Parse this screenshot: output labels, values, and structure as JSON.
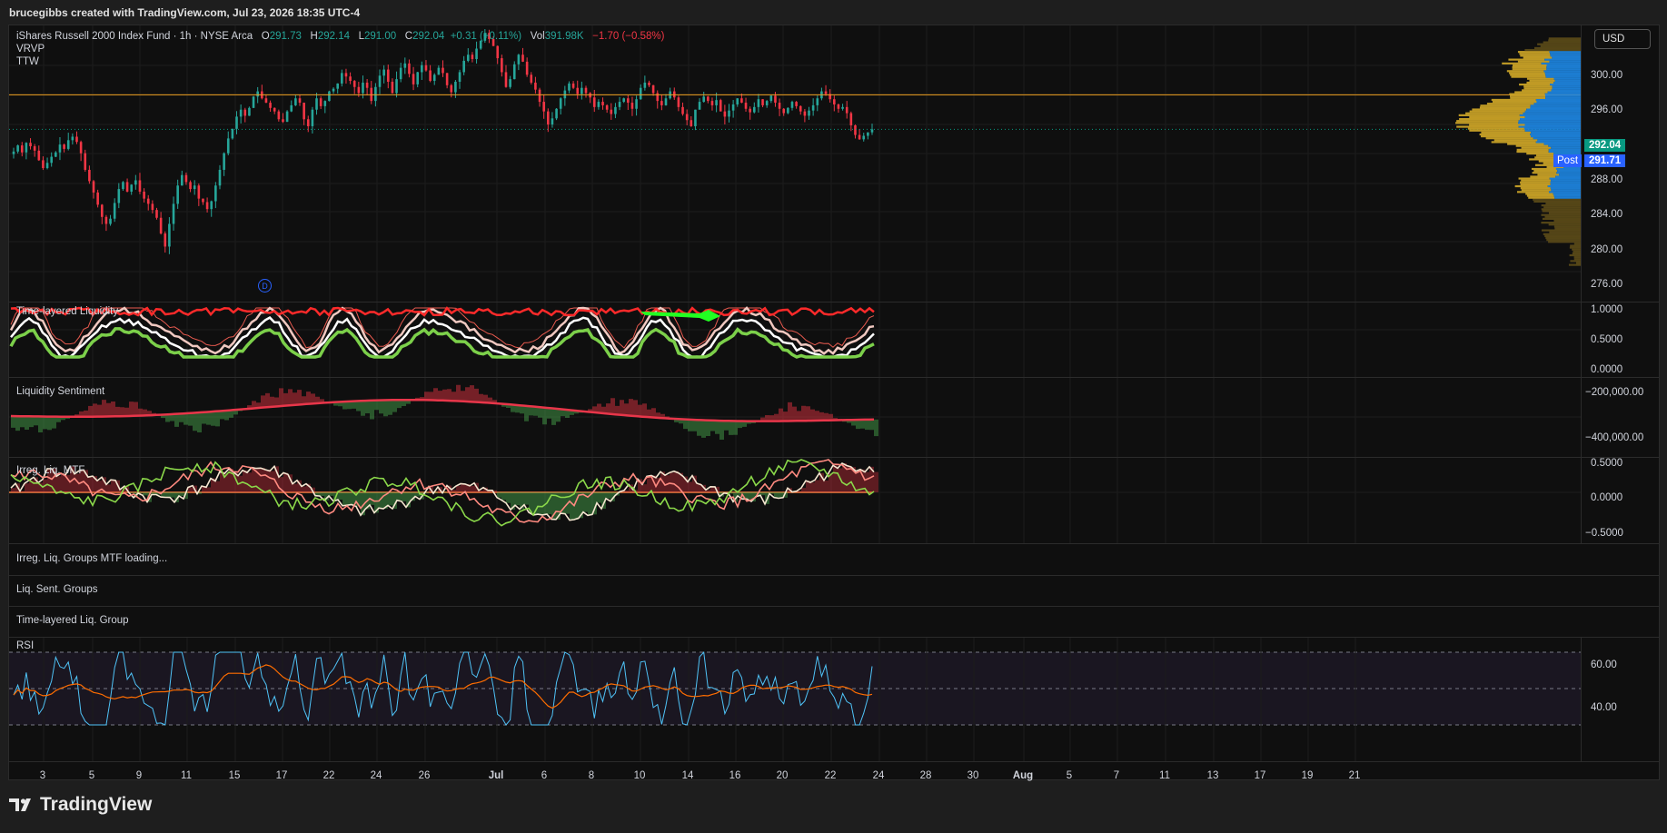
{
  "header": {
    "watermark": "brucegibbs created with TradingView.com, Jul 23, 2026 18:35 UTC-4"
  },
  "legend": {
    "symbol": "iShares Russell 2000 Index Fund · 1h · NYSE Arca",
    "o_label": "O",
    "o": "291.73",
    "h_label": "H",
    "h": "292.14",
    "l_label": "L",
    "l": "291.00",
    "c_label": "C",
    "c": "292.04",
    "change": "+0.31 (+0.11%)",
    "vol_label": "Vol",
    "vol": "391.98K",
    "vol_change": "−1.70 (−0.58%)",
    "indicators": [
      "VRVP",
      "TTW"
    ]
  },
  "currency": "USD",
  "colors": {
    "up": "#26a69a",
    "down": "#f23645",
    "accent_blue": "#2962ff",
    "volume_profile_gold": "#c9a227",
    "volume_profile_blue": "#1e88e5",
    "resistance_line": "#f0a020"
  },
  "price_axis": {
    "ticks": [
      "300.00",
      "296.00",
      "288.00",
      "284.00",
      "280.00",
      "276.00"
    ],
    "last_price": "292.04",
    "post_label": "Post",
    "post_price": "291.71"
  },
  "price_series": {
    "resistance": 296,
    "last": 292.04,
    "close": [
      289.5,
      290.2,
      289.4,
      290.5,
      290.1,
      289.6,
      288.5,
      287.6,
      288.2,
      288.9,
      289.4,
      290.3,
      289.8,
      290.8,
      291.2,
      290.6,
      289.3,
      287.4,
      286.1,
      284.8,
      283.4,
      282.0,
      281.2,
      281.8,
      283.6,
      285.2,
      286.0,
      284.9,
      285.7,
      286.2,
      284.9,
      284.1,
      283.5,
      282.8,
      281.9,
      280.1,
      278.6,
      281.2,
      283.5,
      285.6,
      286.8,
      286.0,
      285.2,
      285.6,
      284.1,
      283.7,
      282.9,
      283.8,
      285.6,
      287.4,
      289.3,
      291.0,
      292.1,
      293.5,
      294.3,
      293.6,
      294.5,
      295.8,
      296.4,
      295.6,
      295.1,
      294.5,
      294.1,
      293.2,
      292.9,
      294.1,
      294.8,
      295.6,
      295.1,
      293.2,
      292.4,
      294.3,
      295.6,
      294.7,
      295.3,
      296.4,
      296.7,
      297.3,
      298.5,
      298.1,
      297.6,
      296.9,
      296.2,
      297.4,
      296.8,
      295.3,
      296.9,
      298.2,
      298.9,
      297.5,
      296.2,
      297.8,
      299.1,
      299.6,
      298.4,
      297.2,
      298.6,
      299.4,
      298.8,
      297.6,
      298.3,
      299.1,
      298.5,
      297.1,
      296.3,
      297.5,
      298.6,
      299.9,
      300.6,
      300.1,
      301.3,
      302.2,
      303.1,
      302.4,
      301.6,
      300.2,
      298.6,
      296.9,
      297.8,
      299.5,
      300.6,
      299.8,
      298.3,
      297.4,
      296.6,
      295.2,
      294.1,
      292.6,
      293.3,
      294.4,
      295.6,
      296.5,
      297.3,
      296.8,
      296.1,
      296.8,
      296.2,
      295.7,
      294.6,
      295.2,
      294.8,
      294.3,
      293.8,
      294.6,
      295.2,
      295.6,
      295.1,
      294.4,
      295.5,
      296.8,
      297.4,
      297.1,
      296.2,
      295.3,
      294.8,
      295.6,
      296.4,
      295.7,
      294.6,
      293.8,
      293.1,
      292.4,
      294.3,
      295.2,
      295.8,
      295.3,
      294.8,
      295.4,
      294.1,
      293.5,
      294.2,
      294.9,
      295.6,
      295.1,
      294.4,
      294.0,
      294.6,
      295.5,
      294.8,
      295.3,
      295.9,
      295.1,
      294.4,
      293.9,
      294.5,
      295.2,
      294.7,
      294.1,
      293.6,
      294.2,
      294.8,
      295.6,
      296.4,
      296.1,
      295.5,
      294.9,
      294.4,
      294.6,
      293.9,
      292.5,
      291.4,
      290.9,
      291.3,
      291.7,
      292.04
    ]
  },
  "panes": {
    "ttl": {
      "title": "Time-layered Liquidity",
      "ticks": [
        "1.0000",
        "0.5000",
        "0.0000"
      ]
    },
    "sentiment": {
      "title": "Liquidity Sentiment",
      "ticks": [
        "−200,000.00",
        "−400,000.00"
      ]
    },
    "irreg": {
      "title": "Irreg. Liq. MTF",
      "ticks": [
        "0.5000",
        "0.0000",
        "−0.5000"
      ]
    },
    "groups_mtf": {
      "title": "Irreg. Liq. Groups MTF loading..."
    },
    "sent_groups": {
      "title": "Liq. Sent. Groups"
    },
    "ttl_group": {
      "title": "Time-layered Liq. Group"
    },
    "rsi": {
      "title": "RSI",
      "ticks": [
        "60.00",
        "40.00"
      ]
    }
  },
  "x_axis": {
    "labels": [
      "3",
      "5",
      "9",
      "11",
      "15",
      "17",
      "22",
      "24",
      "26",
      "Jul",
      "6",
      "8",
      "10",
      "14",
      "16",
      "20",
      "22",
      "24",
      "28",
      "30",
      "Aug",
      "5",
      "7",
      "11",
      "13",
      "17",
      "19",
      "21"
    ]
  },
  "event_marker": "D",
  "brand": "TradingView"
}
